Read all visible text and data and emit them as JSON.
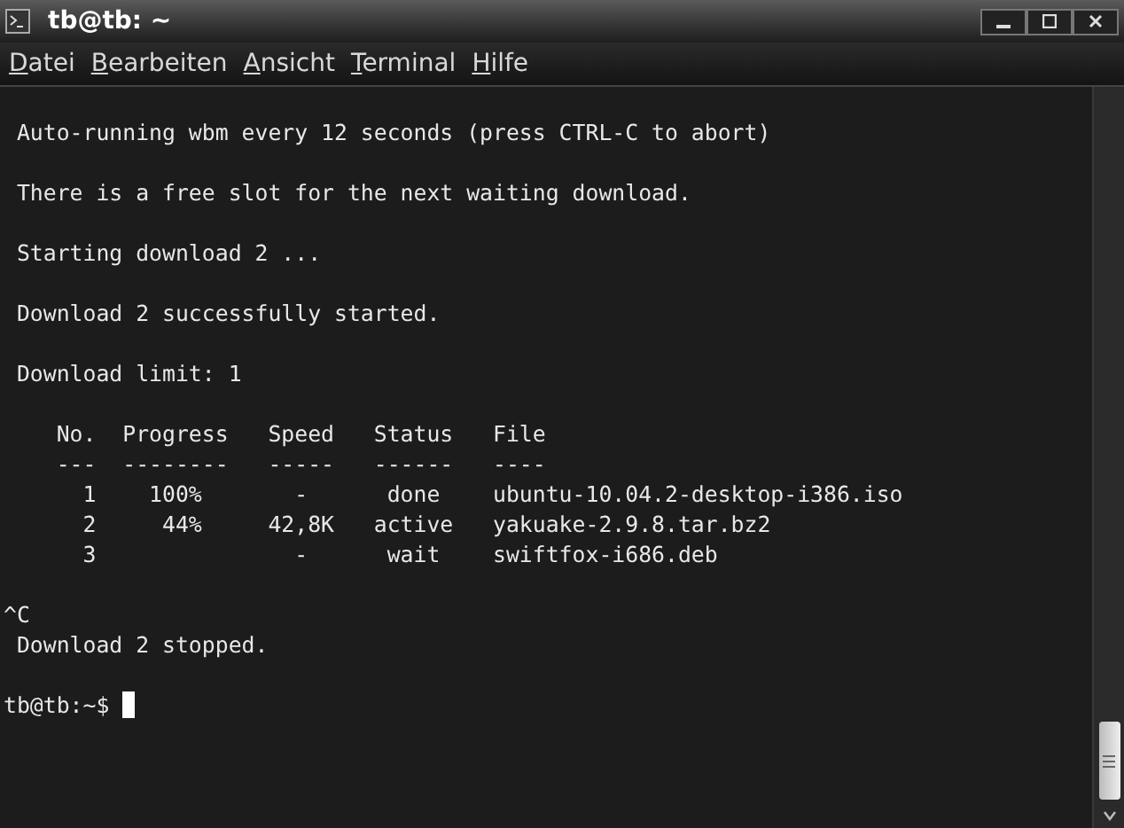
{
  "window": {
    "title": "tb@tb: ~"
  },
  "menu": [
    {
      "key": "D",
      "rest": "atei"
    },
    {
      "key": "B",
      "rest": "earbeiten"
    },
    {
      "key": "A",
      "rest": "nsicht"
    },
    {
      "key": "T",
      "rest": "erminal"
    },
    {
      "key": "H",
      "rest": "ilfe"
    }
  ],
  "terminal": {
    "blocks": [
      [
        " Auto-running wbm every 12 seconds (press CTRL-C to abort)"
      ],
      [
        " There is a free slot for the next waiting download."
      ],
      [
        " Starting download 2 ..."
      ],
      [
        " Download 2 successfully started."
      ],
      [
        " Download limit: 1"
      ],
      [
        "    No.  Progress   Speed   Status   File",
        "    ---  --------   -----   ------   ----",
        "      1    100%       -      done    ubuntu-10.04.2-desktop-i386.iso",
        "      2     44%     42,8K   active   yakuake-2.9.8.tar.bz2",
        "      3               -      wait    swiftfox-i686.deb"
      ],
      [
        "^C",
        " Download 2 stopped."
      ]
    ],
    "prompt": "tb@tb:~$ "
  }
}
